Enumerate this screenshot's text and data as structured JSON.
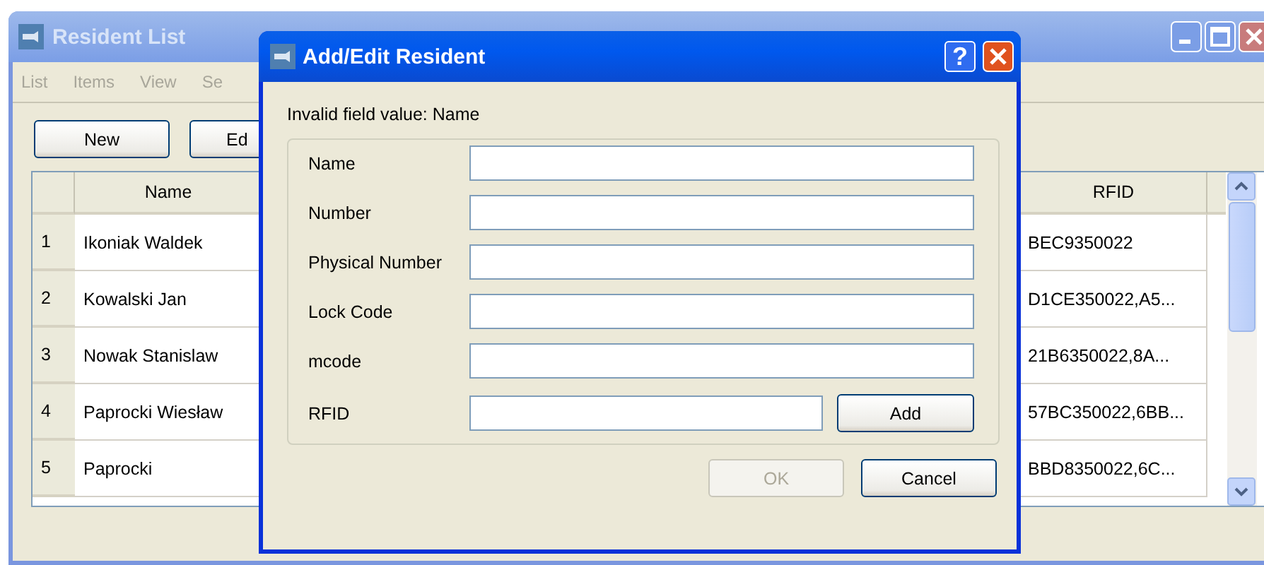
{
  "main_window": {
    "title": "Resident List",
    "menu": [
      "List",
      "Items",
      "View",
      "Se"
    ],
    "buttons": [
      "New",
      "Ed"
    ],
    "table": {
      "columns": [
        "Name",
        "RFID"
      ],
      "rows": [
        {
          "number": "1",
          "name": "Ikoniak Waldek",
          "rfid": "BEC9350022"
        },
        {
          "number": "2",
          "name": "Kowalski Jan",
          "rfid": "D1CE350022,A5..."
        },
        {
          "number": "3",
          "name": "Nowak Stanislaw",
          "rfid": "21B6350022,8A..."
        },
        {
          "number": "4",
          "name": "Paprocki Wiesław",
          "rfid": "57BC350022,6BB..."
        },
        {
          "number": "5",
          "name": "Paprocki",
          "rfid": "BBD8350022,6C..."
        }
      ]
    }
  },
  "dialog": {
    "title": "Add/Edit Resident",
    "help_button": "?",
    "message": "Invalid field value: Name",
    "fields": [
      {
        "label": "Name",
        "kind": "text"
      },
      {
        "label": "Number",
        "kind": "text"
      },
      {
        "label": "Physical Number",
        "kind": "text"
      },
      {
        "label": "Lock Code",
        "kind": "text"
      },
      {
        "label": "mcode",
        "kind": "text"
      },
      {
        "label": "RFID",
        "kind": "with_button",
        "button": "Add"
      }
    ],
    "buttons": [
      {
        "label": "OK",
        "disabled": true
      },
      {
        "label": "Cancel",
        "disabled": false
      }
    ]
  }
}
